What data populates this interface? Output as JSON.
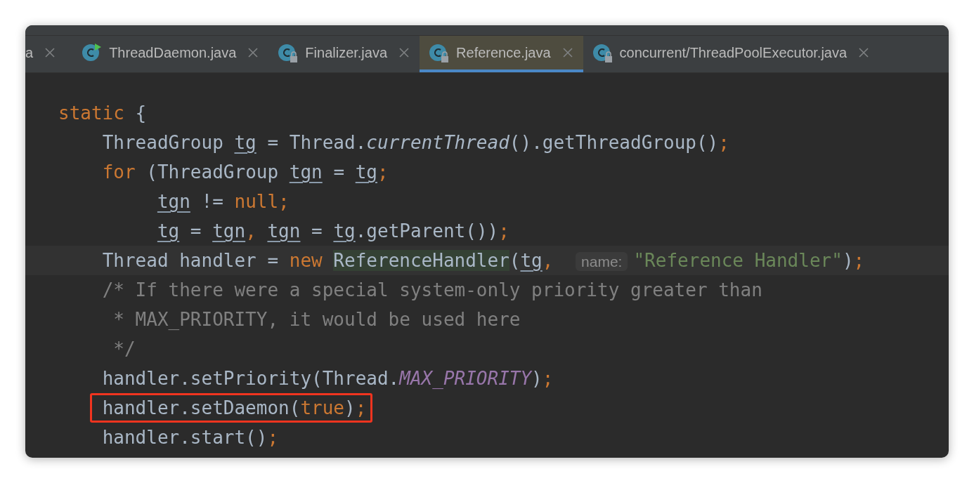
{
  "tabs": [
    {
      "label": "a",
      "selected": false
    },
    {
      "label": "ThreadDaemon.java",
      "selected": false,
      "kind": "run"
    },
    {
      "label": "Finalizer.java",
      "selected": false,
      "kind": "locked"
    },
    {
      "label": "Reference.java",
      "selected": true,
      "kind": "locked"
    },
    {
      "label": "concurrent/ThreadPoolExecutor.java",
      "selected": false,
      "kind": "locked"
    }
  ],
  "code_lines": [
    {
      "tokens": [
        {
          "kind": "keyword",
          "text": "static "
        },
        {
          "kind": "plain",
          "text": "{"
        }
      ]
    },
    {
      "tokens": [
        {
          "kind": "plain",
          "text": "    ThreadGroup "
        },
        {
          "kind": "var",
          "text": "tg"
        },
        {
          "kind": "plain",
          "text": " = Thread."
        },
        {
          "kind": "italic",
          "text": "currentThread"
        },
        {
          "kind": "plain",
          "text": "().getThreadGroup()"
        },
        {
          "kind": "keyword",
          "text": ";"
        }
      ]
    },
    {
      "tokens": [
        {
          "kind": "keyword",
          "text": "    for "
        },
        {
          "kind": "plain",
          "text": "(ThreadGroup "
        },
        {
          "kind": "var",
          "text": "tgn"
        },
        {
          "kind": "plain",
          "text": " = "
        },
        {
          "kind": "var",
          "text": "tg"
        },
        {
          "kind": "keyword",
          "text": ";"
        }
      ]
    },
    {
      "tokens": [
        {
          "kind": "var",
          "text": "         tgn"
        },
        {
          "kind": "plain",
          "text": " != "
        },
        {
          "kind": "keyword",
          "text": "null;"
        }
      ]
    },
    {
      "tokens": [
        {
          "kind": "var",
          "text": "         tg"
        },
        {
          "kind": "plain",
          "text": " = "
        },
        {
          "kind": "var",
          "text": "tgn"
        },
        {
          "kind": "keyword",
          "text": ", "
        },
        {
          "kind": "var",
          "text": "tgn"
        },
        {
          "kind": "plain",
          "text": " = "
        },
        {
          "kind": "var",
          "text": "tg"
        },
        {
          "kind": "plain",
          "text": ".getParent())"
        },
        {
          "kind": "keyword",
          "text": ";"
        }
      ]
    },
    {
      "current": true,
      "tokens": [
        {
          "kind": "plain",
          "text": "    Thread handler = "
        },
        {
          "kind": "keyword",
          "text": "new "
        },
        {
          "kind": "match",
          "text": "ReferenceHandler"
        },
        {
          "kind": "plain",
          "text": "("
        },
        {
          "kind": "var",
          "text": "tg"
        },
        {
          "kind": "keyword",
          "text": ", "
        },
        {
          "kind": "hint",
          "text": "name:"
        },
        {
          "kind": "string",
          "text": "\"Reference Handler\""
        },
        {
          "kind": "plain",
          "text": ")"
        },
        {
          "kind": "keyword",
          "text": ";"
        }
      ]
    },
    {
      "tokens": [
        {
          "kind": "comment",
          "text": "    /* If there were a special system-only priority greater than"
        }
      ]
    },
    {
      "tokens": [
        {
          "kind": "comment",
          "text": "     * MAX_PRIORITY, it would be used here"
        }
      ]
    },
    {
      "tokens": [
        {
          "kind": "comment",
          "text": "     */"
        }
      ]
    },
    {
      "tokens": [
        {
          "kind": "plain",
          "text": "    handler.setPriority(Thread."
        },
        {
          "kind": "constant",
          "text": "MAX_PRIORITY"
        },
        {
          "kind": "plain",
          "text": ")"
        },
        {
          "kind": "keyword",
          "text": ";"
        }
      ]
    },
    {
      "boxed": true,
      "tokens": [
        {
          "kind": "plain",
          "text": "    handler.setDaemon("
        },
        {
          "kind": "keyword",
          "text": "true"
        },
        {
          "kind": "plain",
          "text": ")"
        },
        {
          "kind": "keyword",
          "text": ";"
        }
      ]
    },
    {
      "tokens": [
        {
          "kind": "plain",
          "text": "    handler.start()"
        },
        {
          "kind": "keyword",
          "text": ";"
        }
      ]
    }
  ]
}
